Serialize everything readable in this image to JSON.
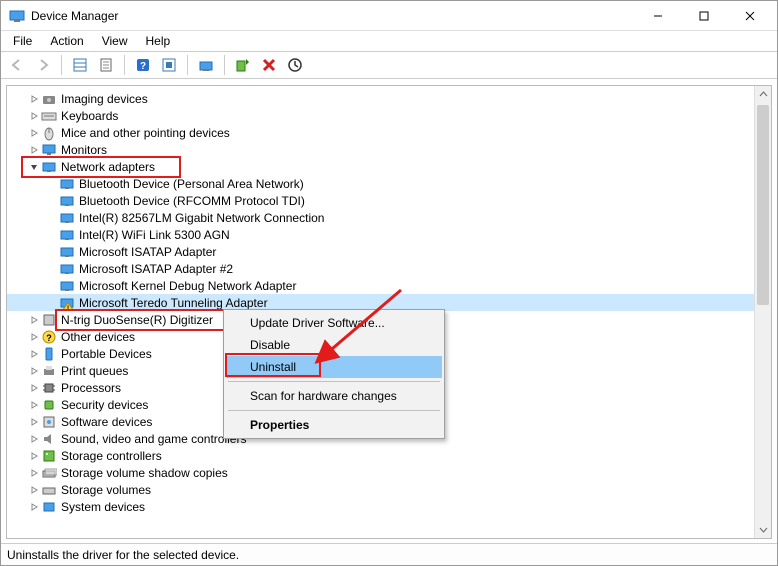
{
  "window": {
    "title": "Device Manager"
  },
  "menu": {
    "file": "File",
    "action": "Action",
    "view": "View",
    "help": "Help"
  },
  "toolbar": {
    "back": "Back",
    "forward": "Forward",
    "show_hide": "Show/Hide Console Tree",
    "properties": "Properties",
    "help": "Help",
    "action_center": "Action Center",
    "scan": "Scan for hardware changes",
    "enable": "Enable",
    "uninstall": "Uninstall",
    "update_driver": "Update driver software"
  },
  "tree": {
    "items": [
      {
        "label": "Imaging devices",
        "icon": "camera-icon",
        "expand": "closed"
      },
      {
        "label": "Keyboards",
        "icon": "keyboard-icon",
        "expand": "closed"
      },
      {
        "label": "Mice and other pointing devices",
        "icon": "mouse-icon",
        "expand": "closed"
      },
      {
        "label": "Monitors",
        "icon": "monitor-icon",
        "expand": "closed"
      },
      {
        "label": "Network adapters",
        "icon": "nic-icon",
        "expand": "open",
        "highlight": true,
        "children": [
          {
            "label": "Bluetooth Device (Personal Area Network)",
            "icon": "nic-icon"
          },
          {
            "label": "Bluetooth Device (RFCOMM Protocol TDI)",
            "icon": "nic-icon"
          },
          {
            "label": "Intel(R) 82567LM Gigabit Network Connection",
            "icon": "nic-icon"
          },
          {
            "label": "Intel(R) WiFi Link 5300 AGN",
            "icon": "nic-icon"
          },
          {
            "label": "Microsoft ISATAP Adapter",
            "icon": "nic-icon"
          },
          {
            "label": "Microsoft ISATAP Adapter #2",
            "icon": "nic-icon"
          },
          {
            "label": "Microsoft Kernel Debug Network Adapter",
            "icon": "nic-icon"
          },
          {
            "label": "Microsoft Teredo Tunneling Adapter",
            "icon": "nic-warning-icon",
            "selected": true,
            "highlight": true
          }
        ]
      },
      {
        "label": "N-trig DuoSense(R) Digitizer",
        "icon": "hid-icon",
        "expand": "closed"
      },
      {
        "label": "Other devices",
        "icon": "unknown-icon",
        "expand": "closed"
      },
      {
        "label": "Portable Devices",
        "icon": "portable-icon",
        "expand": "closed"
      },
      {
        "label": "Print queues",
        "icon": "printer-icon",
        "expand": "closed"
      },
      {
        "label": "Processors",
        "icon": "cpu-icon",
        "expand": "closed"
      },
      {
        "label": "Security devices",
        "icon": "security-icon",
        "expand": "closed"
      },
      {
        "label": "Software devices",
        "icon": "software-icon",
        "expand": "closed"
      },
      {
        "label": "Sound, video and game controllers",
        "icon": "audio-icon",
        "expand": "closed"
      },
      {
        "label": "Storage controllers",
        "icon": "storage-icon",
        "expand": "closed"
      },
      {
        "label": "Storage volume shadow copies",
        "icon": "shadow-icon",
        "expand": "closed"
      },
      {
        "label": "Storage volumes",
        "icon": "volume-icon",
        "expand": "closed"
      },
      {
        "label": "System devices",
        "icon": "system-icon",
        "expand": "closed"
      }
    ]
  },
  "context_menu": {
    "items": [
      {
        "label": "Update Driver Software...",
        "type": "item"
      },
      {
        "label": "Disable",
        "type": "item"
      },
      {
        "label": "Uninstall",
        "type": "item",
        "hover": true,
        "highlight": true
      },
      {
        "type": "sep"
      },
      {
        "label": "Scan for hardware changes",
        "type": "item"
      },
      {
        "type": "sep"
      },
      {
        "label": "Properties",
        "type": "item",
        "bold": true
      }
    ]
  },
  "status": {
    "text": "Uninstalls the driver for the selected device."
  },
  "colors": {
    "highlight": "#e21b1b",
    "selection": "#cce8ff",
    "menu_hover": "#91c9f7"
  }
}
